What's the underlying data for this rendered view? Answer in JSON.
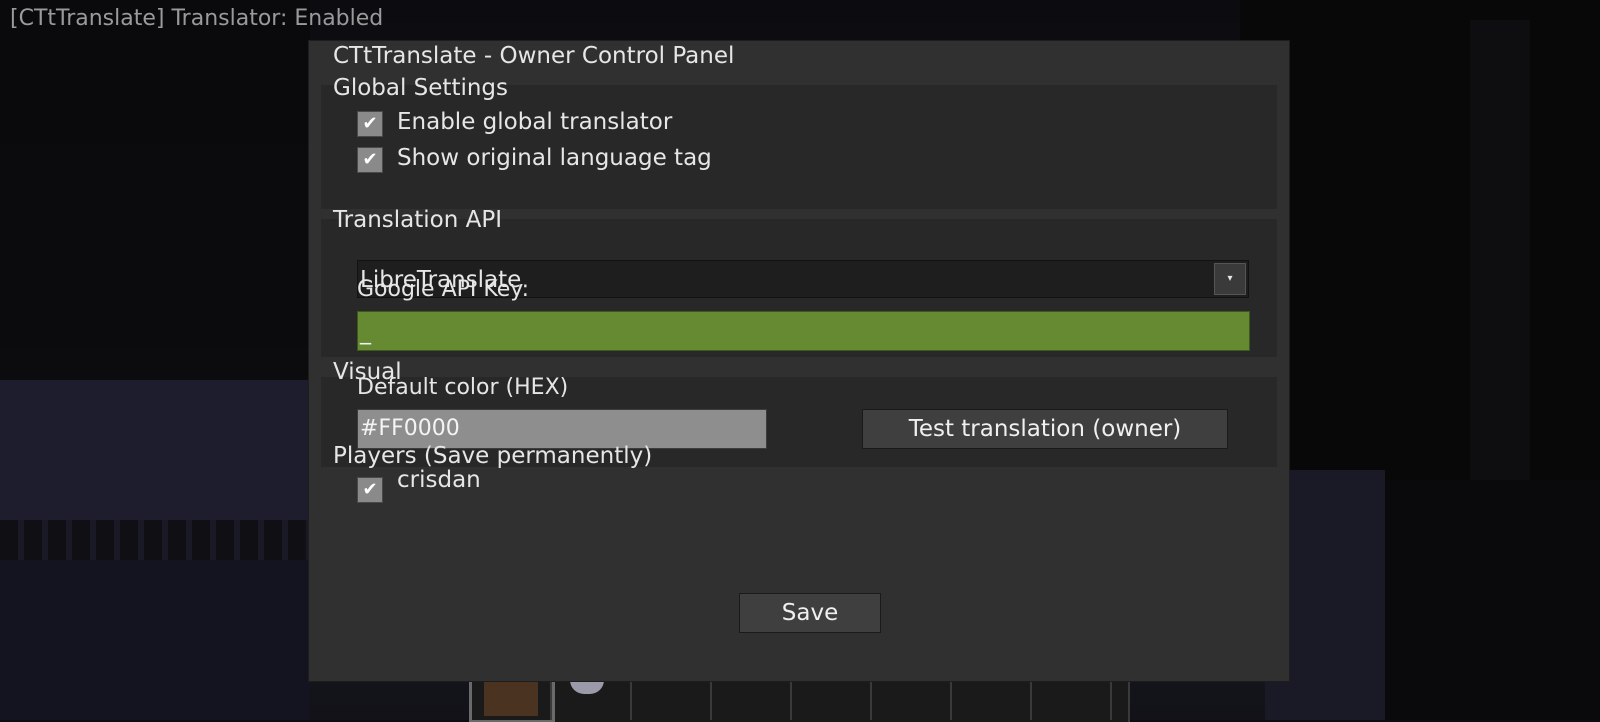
{
  "status_line": "[CTtTranslate] Translator: Enabled",
  "panel": {
    "title": "CTtTranslate - Owner Control Panel"
  },
  "global_settings": {
    "label": "Global Settings",
    "options": [
      {
        "label": "Enable global translator",
        "checked": true
      },
      {
        "label": "Show original language tag",
        "checked": true
      }
    ]
  },
  "translation_api": {
    "label": "Translation API",
    "selected_provider": "LibreTranslate",
    "api_key_label": "Google API Key:",
    "api_key_value": "_",
    "api_key_color": "#658a32"
  },
  "visual": {
    "label": "Visual",
    "color_label": "Default color (HEX)",
    "color_value": "#FF0000",
    "test_button": "Test translation (owner)"
  },
  "players": {
    "label": "Players (Save permanently)",
    "items": [
      {
        "name": "crisdan",
        "checked": true
      }
    ]
  },
  "save_button": "Save",
  "checkmark_glyph": "✔",
  "dropdown_glyph": "▾"
}
